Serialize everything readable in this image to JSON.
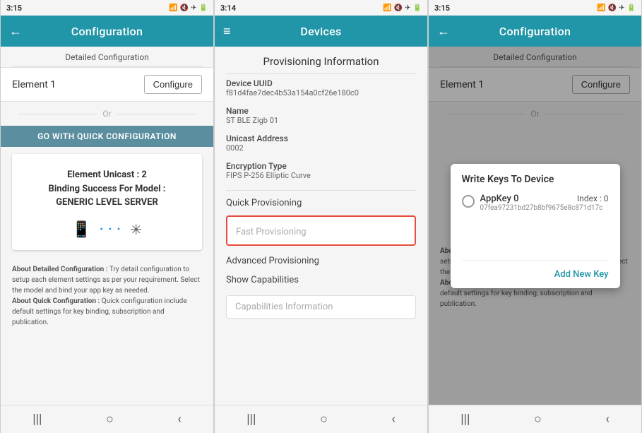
{
  "phone1": {
    "statusBar": {
      "time": "3:15",
      "icons": "📶🔕✈🔋"
    },
    "appBar": {
      "title": "Configuration",
      "backIcon": "←"
    },
    "subtitle": "Detailed Configuration",
    "elementLabel": "Element 1",
    "configureBtn": "Configure",
    "orLabel": "Or",
    "quickConfigHeader": "GO WITH QUICK CONFIGURATION",
    "popupText": "Element Unicast : 2\nBinding Success For Model :\nGENERIC LEVEL SERVER",
    "bottomInfo1Title": "About Detailed Configuration :",
    "bottomInfo1": "Try detail configuration to setup each element settings as per your requirement. Select the model and bind your app key as needed.",
    "bottomInfo2Title": "About Quick Configuration :",
    "bottomInfo2": "Quick configuration include default settings for key binding, subscription and publication.",
    "navItems": [
      "|||",
      "○",
      "‹"
    ]
  },
  "phone2": {
    "statusBar": {
      "time": "3:14",
      "icons": "📶🔕✈🔋"
    },
    "appBar": {
      "title": "Devices",
      "hamburgerIcon": "≡"
    },
    "provInfoTitle": "Provisioning Information",
    "deviceUUIDLabel": "Device UUID",
    "deviceUUIDVal": "f81d4fae7dec4b53a154a0cf26e180c0",
    "nameLabel": "Name",
    "nameVal": "ST BLE Zigb 01",
    "unicastLabel": "Unicast Address",
    "unicastVal": "0002",
    "encryptionLabel": "Encryption Type",
    "encryptionVal": "FIPS P-256 Elliptic Curve",
    "quickProvLabel": "Quick Provisioning",
    "fastProvPlaceholder": "Fast Provisioning",
    "advProvLabel": "Advanced Provisioning",
    "showCapLabel": "Show Capabilities",
    "capInfoPlaceholder": "Capabilities Information",
    "navItems": [
      "|||",
      "○",
      "‹"
    ]
  },
  "phone3": {
    "statusBar": {
      "time": "3:15",
      "icons": "📶🔕✈🔋"
    },
    "appBar": {
      "title": "Configuration",
      "backIcon": "←"
    },
    "subtitle": "Detailed Configuration",
    "elementLabel": "Element 1",
    "configureBtn": "Configure",
    "orLabel": "Or",
    "modal": {
      "title": "Write Keys To Device",
      "key0Name": "AppKey 0",
      "key0Index": "Index : 0",
      "key0Hash": "07fea97231bd27b8bf9675e8c871d17c",
      "addNewKeyBtn": "Add New Key"
    },
    "bottomInfo1Title": "About Detailed Configuration :",
    "bottomInfo1": "Try detail configuration to setup each element settings as per your requirement. Select the model and bind your app key as needed.",
    "bottomInfo2Title": "About Quick Configuration :",
    "bottomInfo2": "Quick configuration include default settings for key binding, subscription and publication.",
    "navItems": [
      "|||",
      "○",
      "‹"
    ]
  }
}
